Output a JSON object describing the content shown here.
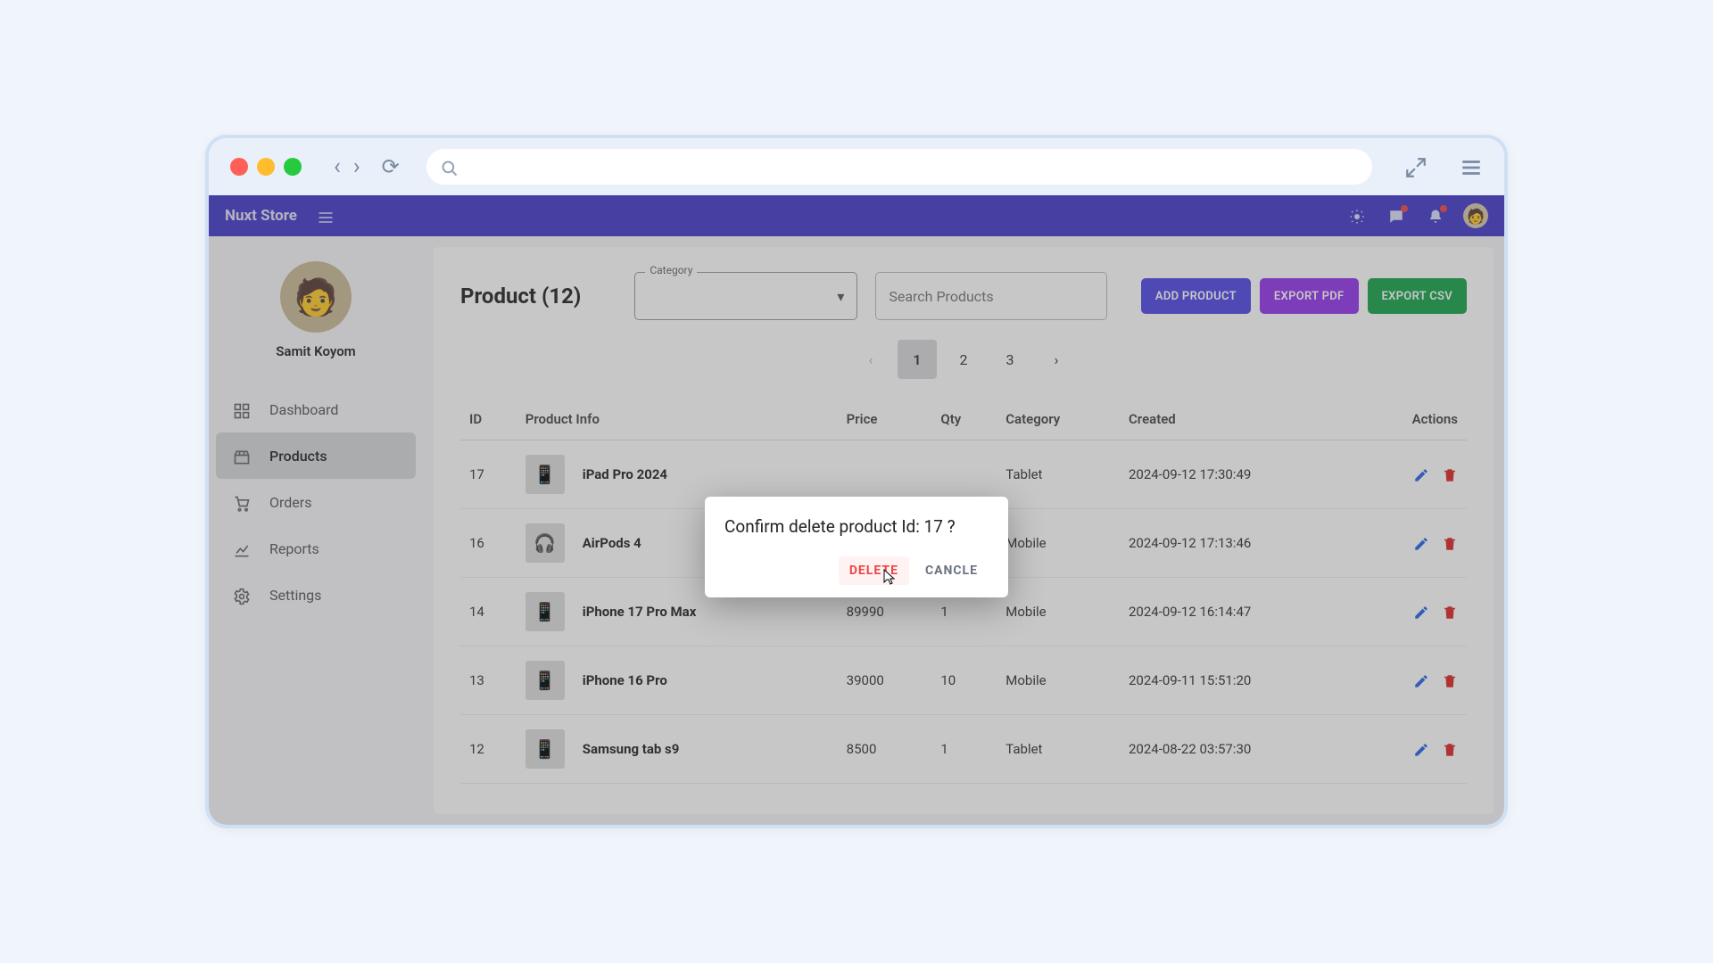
{
  "app": {
    "brand": "Nuxt Store"
  },
  "profile": {
    "name": "Samit Koyom"
  },
  "sidebar": {
    "items": [
      {
        "label": "Dashboard",
        "icon": "dashboard-icon"
      },
      {
        "label": "Products",
        "icon": "products-icon"
      },
      {
        "label": "Orders",
        "icon": "cart-icon"
      },
      {
        "label": "Reports",
        "icon": "chart-icon"
      },
      {
        "label": "Settings",
        "icon": "gear-icon"
      }
    ],
    "active_index": 1
  },
  "page": {
    "title": "Product (12)",
    "category_label": "Category",
    "search_placeholder": "Search Products",
    "buttons": {
      "add": "ADD PRODUCT",
      "export_pdf": "EXPORT PDF",
      "export_csv": "EXPORT CSV"
    }
  },
  "pagination": {
    "pages": [
      "1",
      "2",
      "3"
    ],
    "active": "1"
  },
  "table": {
    "headers": [
      "ID",
      "Product Info",
      "Price",
      "Qty",
      "Category",
      "Created",
      "Actions"
    ],
    "rows": [
      {
        "id": "17",
        "name": "iPad Pro 2024",
        "price": "",
        "qty": "",
        "category": "Tablet",
        "created": "2024-09-12 17:30:49"
      },
      {
        "id": "16",
        "name": "AirPods 4",
        "price": "",
        "qty": "",
        "category": "Mobile",
        "created": "2024-09-12 17:13:46"
      },
      {
        "id": "14",
        "name": "iPhone 17 Pro Max",
        "price": "89990",
        "qty": "1",
        "category": "Mobile",
        "created": "2024-09-12 16:14:47"
      },
      {
        "id": "13",
        "name": "iPhone 16 Pro",
        "price": "39000",
        "qty": "10",
        "category": "Mobile",
        "created": "2024-09-11 15:51:20"
      },
      {
        "id": "12",
        "name": "Samsung tab s9",
        "price": "8500",
        "qty": "1",
        "category": "Tablet",
        "created": "2024-08-22 03:57:30"
      }
    ]
  },
  "dialog": {
    "title": "Confirm delete product Id: 17 ?",
    "delete_label": "DELETE",
    "cancel_label": "CANCLE"
  }
}
